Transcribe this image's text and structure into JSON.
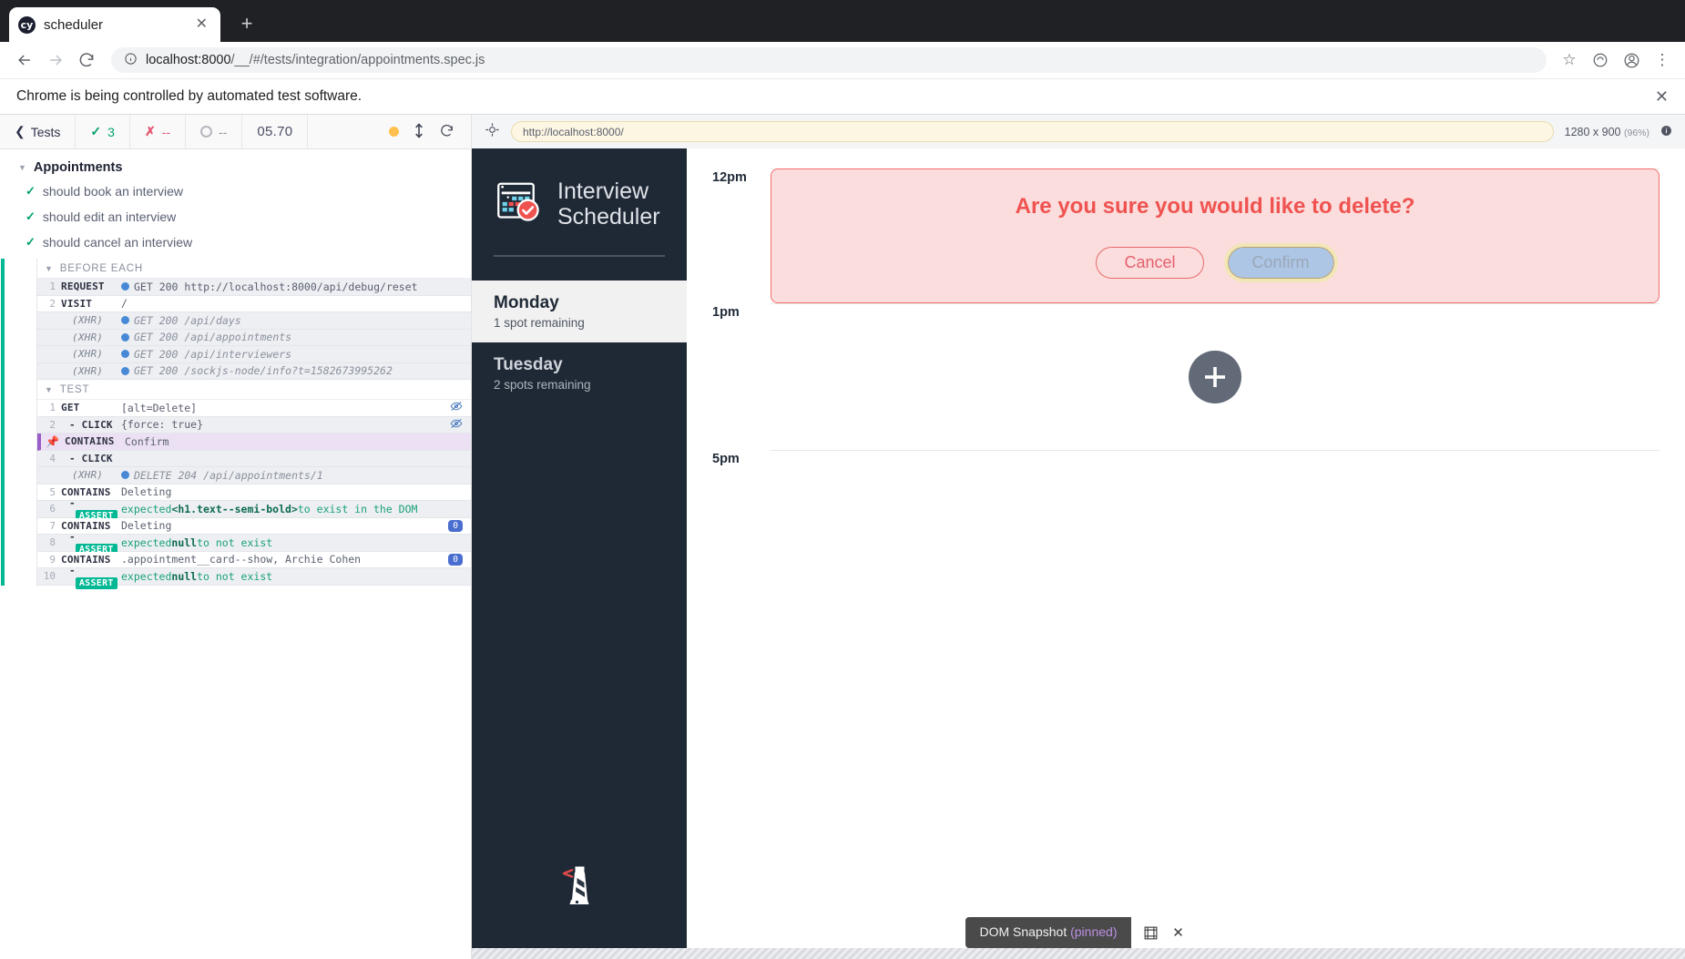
{
  "browser": {
    "tab": {
      "title": "scheduler",
      "favicon_label": "cy",
      "close_icon": "close-icon"
    },
    "new_tab_label": "+",
    "nav": {
      "back": "←",
      "forward": "→",
      "reload": "⟳"
    },
    "omnibox": {
      "info_icon": "ⓘ",
      "host": "localhost:8000",
      "path": "/__/#/tests/integration/appointments.spec.js",
      "full_url": "localhost:8000/__/#/tests/integration/appointments.spec.js"
    },
    "toolbar_icons": [
      "star-icon",
      "extension-icon",
      "profile-icon",
      "menu-icon"
    ],
    "infobar": {
      "message": "Chrome is being controlled by automated test software.",
      "close": "✕"
    }
  },
  "reporter": {
    "back_label": "Tests",
    "stats": {
      "passed": "3",
      "failed": "--",
      "pending": "--",
      "duration": "05.70"
    },
    "suite": {
      "name": "Appointments",
      "tests": [
        {
          "title": "should book an interview",
          "state": "passed"
        },
        {
          "title": "should edit an interview",
          "state": "passed"
        },
        {
          "title": "should cancel an interview",
          "state": "passed"
        }
      ]
    },
    "hooks": [
      {
        "label": "BEFORE EACH",
        "commands": [
          {
            "num": "1",
            "name": "REQUEST",
            "message": "GET 200 http://localhost:8000/api/debug/reset",
            "type": "request",
            "dot": true
          },
          {
            "num": "2",
            "name": "VISIT",
            "message": "/",
            "type": "command"
          },
          {
            "num": "",
            "name": "(XHR)",
            "message": "GET 200 /api/days",
            "type": "xhr",
            "dot": true
          },
          {
            "num": "",
            "name": "(XHR)",
            "message": "GET 200 /api/appointments",
            "type": "xhr",
            "dot": true
          },
          {
            "num": "",
            "name": "(XHR)",
            "message": "GET 200 /api/interviewers",
            "type": "xhr",
            "dot": true
          },
          {
            "num": "",
            "name": "(XHR)",
            "message": "GET 200 /sockjs-node/info?t=1582673995262",
            "type": "xhr",
            "dot": true
          }
        ]
      },
      {
        "label": "TEST",
        "commands": [
          {
            "num": "1",
            "name": "GET",
            "message": "[alt=Delete]",
            "type": "command",
            "right_icon": "eye-off-icon"
          },
          {
            "num": "2",
            "name": "- CLICK",
            "message": "{force: true}",
            "type": "child",
            "right_icon": "eye-off-icon"
          },
          {
            "num": "3",
            "name": "CONTAINS",
            "message": "Confirm",
            "type": "command",
            "pinned": true,
            "pin_icon": "pin-icon"
          },
          {
            "num": "4",
            "name": "- CLICK",
            "message": "",
            "type": "child"
          },
          {
            "num": "",
            "name": "(XHR)",
            "message": "DELETE 204 /api/appointments/1",
            "type": "xhr",
            "dot": true
          },
          {
            "num": "5",
            "name": "CONTAINS",
            "message": "Deleting",
            "type": "command"
          },
          {
            "num": "6",
            "name": "- ASSERT",
            "message": "expected <h1.text--semi-bold> to exist in the DOM",
            "type": "assert",
            "assert_parts": {
              "pre": "expected ",
              "bold": "<h1.text--semi-bold>",
              "post": " to exist in the DOM"
            }
          },
          {
            "num": "7",
            "name": "CONTAINS",
            "message": "Deleting",
            "type": "command",
            "badge": "0"
          },
          {
            "num": "8",
            "name": "- ASSERT",
            "message": "expected null to not exist",
            "type": "assert",
            "assert_parts": {
              "pre": "expected ",
              "bold": "null",
              "post": " to not exist"
            }
          },
          {
            "num": "9",
            "name": "CONTAINS",
            "message": ".appointment__card--show, Archie Cohen",
            "type": "command",
            "badge": "0"
          },
          {
            "num": "10",
            "name": "- ASSERT",
            "message": "expected null to not exist",
            "type": "assert",
            "assert_parts": {
              "pre": "expected ",
              "bold": "null",
              "post": " to not exist"
            }
          }
        ]
      }
    ]
  },
  "aut": {
    "selector_icon": "selector-playground-icon",
    "url": "http://localhost:8000/",
    "viewport": "1280 x 900",
    "scale": "(96%)",
    "info_icon": "info-icon"
  },
  "app": {
    "brand": {
      "line1": "Interview",
      "line2": "Scheduler",
      "icon": "calendar-check-icon"
    },
    "days": [
      {
        "name": "Monday",
        "spots": "1 spot remaining",
        "selected": true
      },
      {
        "name": "Tuesday",
        "spots": "2 spots remaining",
        "selected": false
      }
    ],
    "footer_icon": "lighthouse-icon",
    "schedule": [
      {
        "time": "12pm",
        "content": "confirm"
      },
      {
        "time": "1pm",
        "content": "add"
      },
      {
        "time": "5pm",
        "content": "empty"
      }
    ],
    "confirm_dialog": {
      "question": "Are you sure you would like to delete?",
      "cancel_label": "Cancel",
      "confirm_label": "Confirm"
    },
    "add_button_icon": "plus-icon"
  },
  "snapshot": {
    "label": "DOM Snapshot",
    "state": "(pinned)",
    "toggle_icon": "snapshot-toggle-icon",
    "close_icon": "close-icon"
  },
  "colors": {
    "pass_green": "#00a06c",
    "fail_red": "#e45770",
    "pinned_purple": "#9a5cc6",
    "xhr_blue": "#4789d6",
    "assert_green": "#00b894",
    "danger_red": "#ef5350",
    "nav_dark": "#1f2936"
  }
}
